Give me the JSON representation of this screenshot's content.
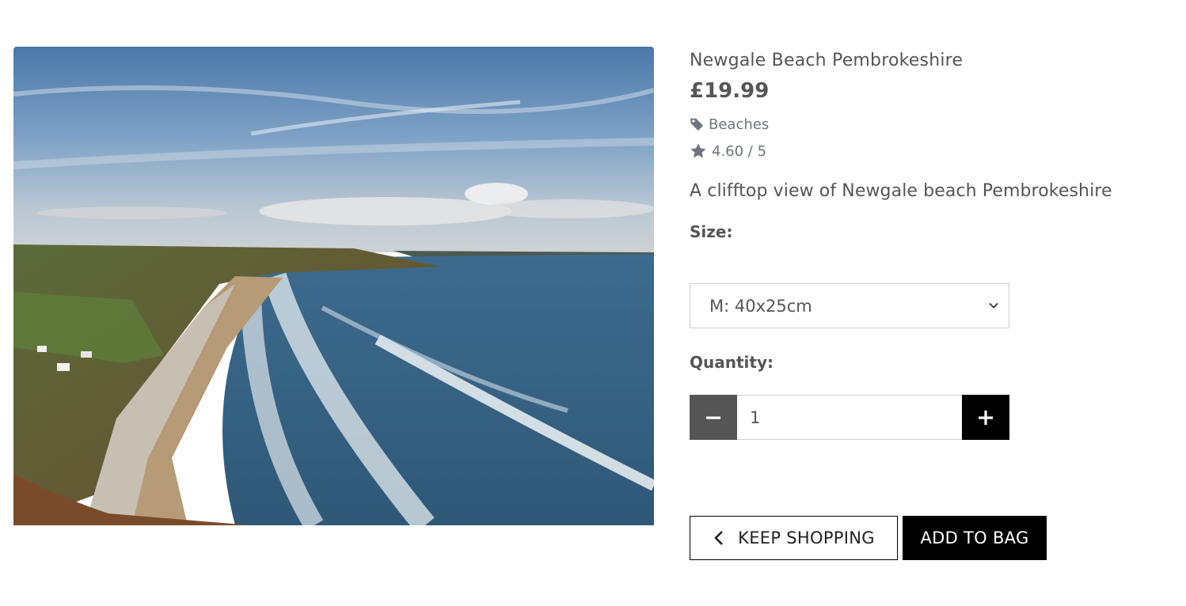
{
  "product": {
    "name": "Newgale Beach Pembrokeshire",
    "price": "£19.99",
    "category": "Beaches",
    "category_icon": "tag-icon",
    "rating": "4.60 / 5",
    "rating_icon": "star-icon",
    "description": "A clifftop view of Newgale beach Pembrokeshire",
    "image": "newgale-beach-photo"
  },
  "size": {
    "label": "Size:",
    "selected": "M: 40x25cm"
  },
  "quantity": {
    "label": "Quantity:",
    "value": "1"
  },
  "buttons": {
    "keep_shopping": "KEEP SHOPPING",
    "add_to_bag": "ADD TO BAG"
  },
  "colors": {
    "text": "#555555",
    "muted": "#6c757d",
    "dark_button": "#000000",
    "minus_button": "#555555"
  }
}
